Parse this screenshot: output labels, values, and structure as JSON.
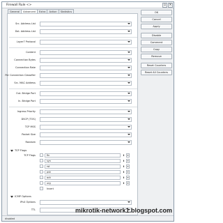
{
  "window": {
    "title": "Firewall Rule <>",
    "status": "disabled"
  },
  "tabs": [
    "General",
    "Advanced",
    "Extra",
    "Action",
    "Statistics"
  ],
  "fields": [
    {
      "label": "Src. Address List"
    },
    {
      "label": "Dst. Address List"
    },
    {
      "label": "Layer7 Protocol"
    },
    {
      "label": "Content"
    },
    {
      "label": "Connection Bytes"
    },
    {
      "label": "Connection Rate"
    },
    {
      "label": "Per Connection Classifier"
    },
    {
      "label": "Src. MAC Address"
    },
    {
      "label": "Out. Bridge Port"
    },
    {
      "label": "In. Bridge Port"
    },
    {
      "label": "Ingress Priority"
    },
    {
      "label": "DSCP (TOS)"
    },
    {
      "label": "TCP MSS"
    },
    {
      "label": "Packet Size"
    },
    {
      "label": "Random"
    }
  ],
  "tcp_flags_section": {
    "title": "TCP Flags",
    "label": "TCP Flags",
    "flags": [
      "fin",
      "syn",
      "rst",
      "psh",
      "ack",
      "urg"
    ],
    "invert_label": "Invert"
  },
  "icmp_section": {
    "title": "ICMP Options",
    "ipv4_label": "IPv4 Options",
    "ttl_label": "TTL"
  },
  "buttons": [
    "OK",
    "Cancel",
    "Apply",
    "Disable",
    "Comment",
    "Copy",
    "Remove",
    "Reset Counters",
    "Reset All Counters"
  ],
  "watermark": "mikrotik-network1.blogspot.com"
}
